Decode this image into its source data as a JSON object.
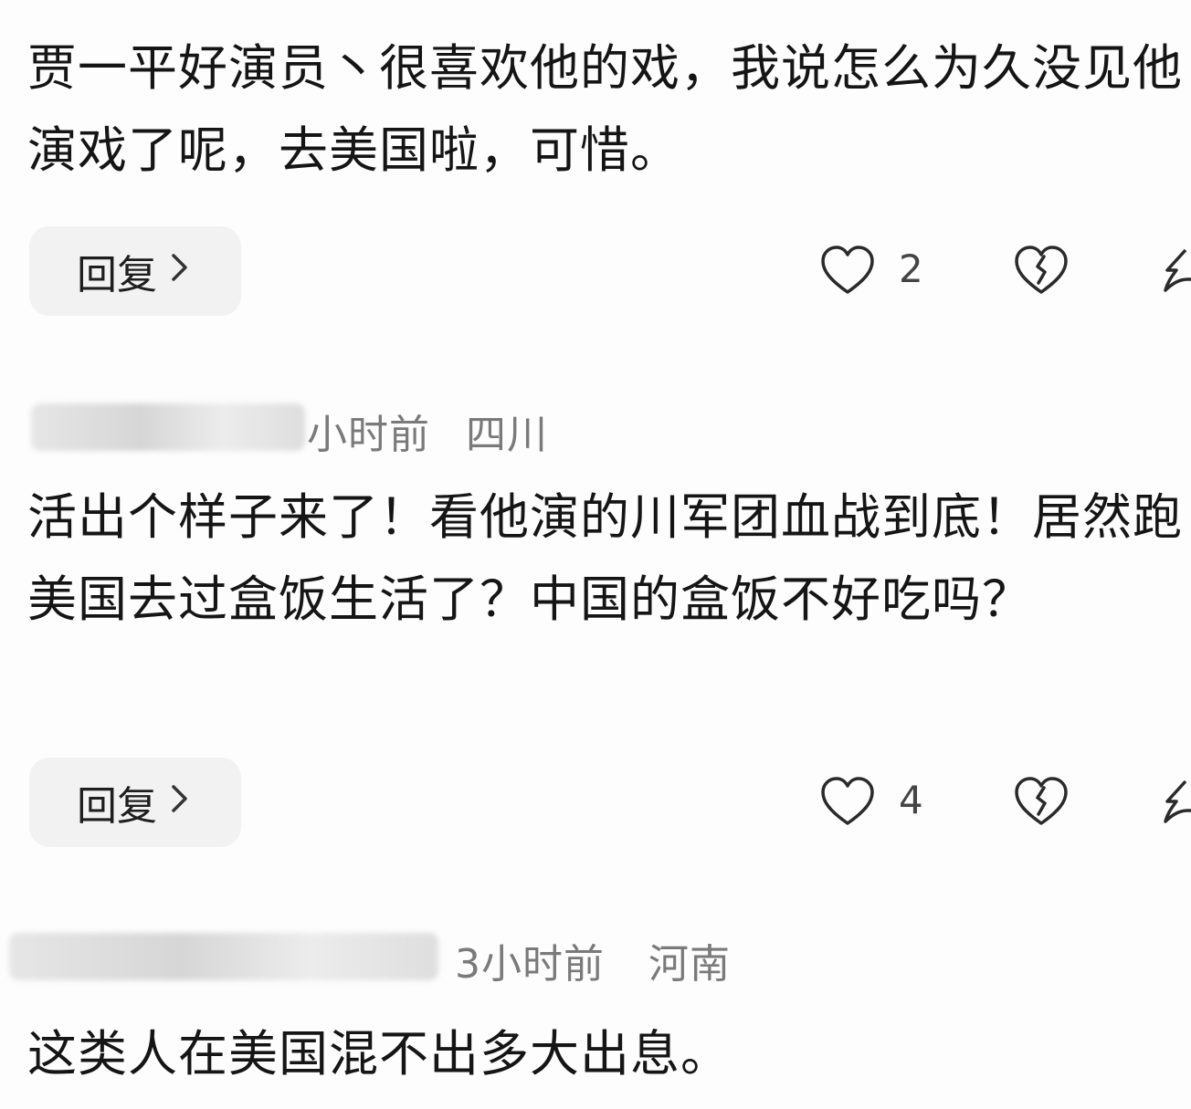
{
  "comments": [
    {
      "text": "贾一平好演员丶很喜欢他的戏，我说怎么为久没见他演戏了呢，去美国啦，可惜。",
      "reply_label": "回复",
      "likes": "2"
    },
    {
      "time": "小时前",
      "location": "四川",
      "text": "活出个样子来了！看他演的川军团血战到底！居然跑美国去过盒饭生活了？中国的盒饭不好吃吗？",
      "reply_label": "回复",
      "likes": "4"
    },
    {
      "time": "3小时前",
      "location": "河南",
      "text": "这类人在美国混不出多大出息。"
    }
  ],
  "icons": {
    "reply_chevron": "chevron-right-icon",
    "like": "heart-icon",
    "dislike": "broken-heart-icon",
    "share": "share-icon"
  },
  "colors": {
    "text": "#151515",
    "meta": "#7a7a7a",
    "pill_bg": "#f2f2f2",
    "icon_stroke": "#2a2a2a"
  }
}
